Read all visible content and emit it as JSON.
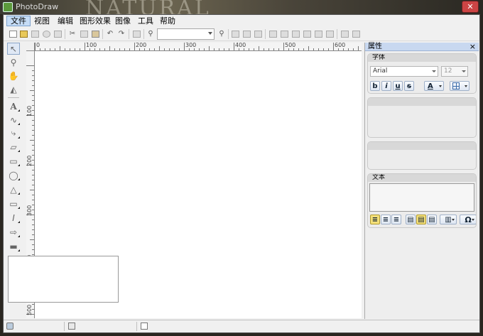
{
  "window": {
    "title": "PhotoDraw",
    "bg_text": "NATURAL"
  },
  "menu": [
    {
      "label": "文件",
      "active": true
    },
    {
      "label": "视图"
    },
    {
      "label": "编辑"
    },
    {
      "label": "图形效果"
    },
    {
      "label": "图像"
    },
    {
      "label": "工具"
    },
    {
      "label": "帮助"
    }
  ],
  "toolbar": {
    "zoom_value": ""
  },
  "ruler": {
    "h_labels": [
      "0",
      "100",
      "200",
      "300",
      "400",
      "500",
      "600"
    ],
    "v_labels": [
      "100",
      "200",
      "300",
      "400",
      "500"
    ]
  },
  "properties": {
    "title": "属性",
    "close_glyph": "×",
    "font_group": {
      "header": "字体",
      "font_name": "Arial",
      "font_size": "12",
      "bold": "b",
      "italic": "i",
      "underline": "u",
      "strike": "s",
      "color_label": "A"
    },
    "text_group": {
      "header": "文本",
      "omega": "Ω"
    }
  },
  "colors": {
    "accent": "#c5dcf6",
    "panel_header": "#c8d8f0"
  }
}
